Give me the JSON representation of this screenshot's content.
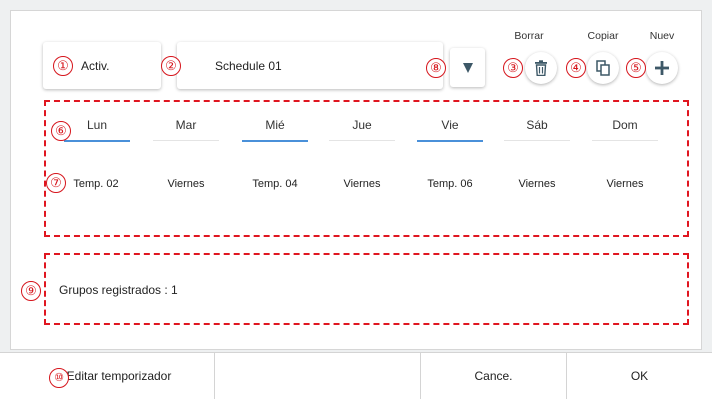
{
  "top": {
    "mode": "Activ.",
    "schedule": "Schedule 01"
  },
  "actions": {
    "delete": "Borrar",
    "copy": "Copiar",
    "new": "Nuev"
  },
  "markers": [
    "①",
    "②",
    "③",
    "④",
    "⑤",
    "⑥",
    "⑦",
    "⑧",
    "⑨",
    "⑩"
  ],
  "days": [
    {
      "label": "Lun",
      "value": "Temp. 02",
      "selected": true
    },
    {
      "label": "Mar",
      "value": "Viernes",
      "selected": false
    },
    {
      "label": "Mié",
      "value": "Temp. 04",
      "selected": true
    },
    {
      "label": "Jue",
      "value": "Viernes",
      "selected": false
    },
    {
      "label": "Vie",
      "value": "Temp. 06",
      "selected": true
    },
    {
      "label": "Sáb",
      "value": "Viernes",
      "selected": false
    },
    {
      "label": "Dom",
      "value": "Viernes",
      "selected": false
    }
  ],
  "groups": {
    "label": "Grupos registrados : 1"
  },
  "bottom": {
    "edit": "Editar temporizador",
    "cancel": "Cance.",
    "ok": "OK"
  },
  "colors": {
    "annotation": "#d6151c",
    "selected_underline": "#4a90d9",
    "icon": "#3d5867"
  },
  "icons": [
    "dropdown-arrow-icon",
    "trash-icon",
    "copy-icon",
    "plus-icon"
  ]
}
